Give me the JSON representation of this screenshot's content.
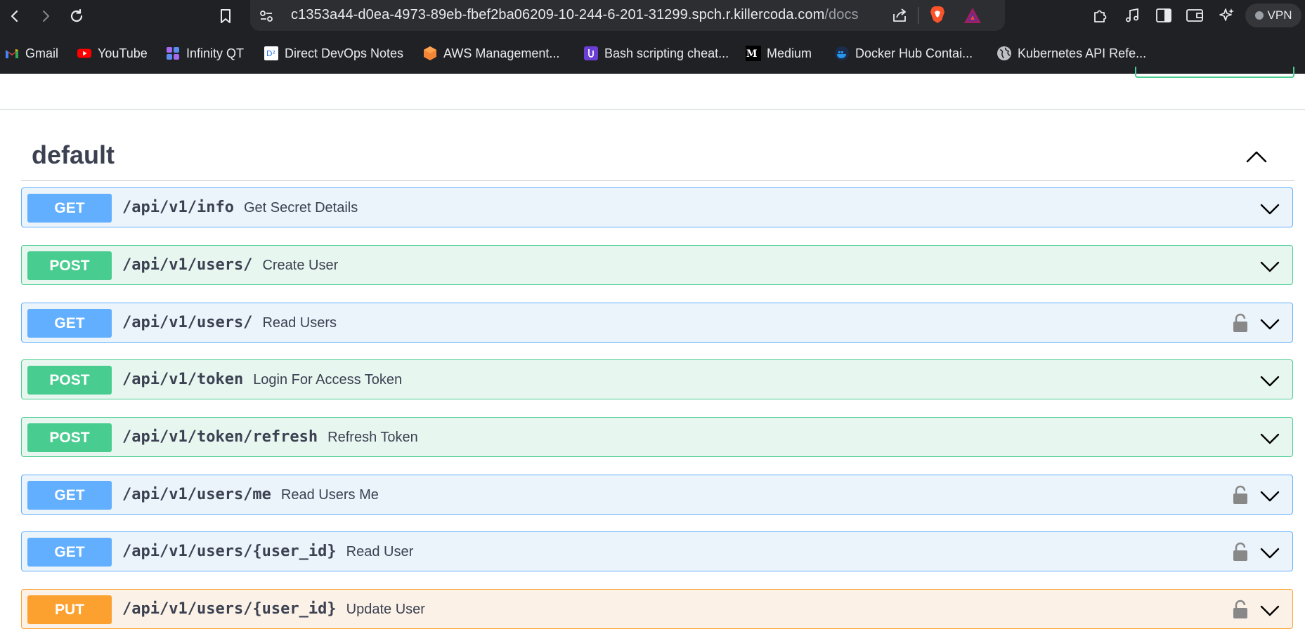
{
  "browser": {
    "url_main": "c1353a44-d0ea-4973-89eb-fbef2ba06209-10-244-6-201-31299.spch.r.killercoda.com",
    "url_path": "/docs",
    "vpn_label": "VPN",
    "icons": [
      "back-icon",
      "forward-icon",
      "reload-icon",
      "bookmark-icon",
      "site-settings-icon",
      "share-icon",
      "brave-shields-icon",
      "brave-rewards-icon",
      "extensions-icon",
      "media-icon",
      "sidebar-icon",
      "wallet-icon",
      "leo-ai-icon"
    ]
  },
  "bookmarks": [
    {
      "label": "Gmail",
      "icon": "gmail-icon"
    },
    {
      "label": "YouTube",
      "icon": "youtube-icon"
    },
    {
      "label": "Infinity QT",
      "icon": "infinity-qt-icon"
    },
    {
      "label": "Direct DevOps Notes",
      "icon": "devops-notes-icon"
    },
    {
      "label": "AWS Management...",
      "icon": "aws-icon"
    },
    {
      "label": "Bash scripting cheat...",
      "icon": "bash-icon"
    },
    {
      "label": "Medium",
      "icon": "medium-icon"
    },
    {
      "label": "Docker Hub Contai...",
      "icon": "docker-icon"
    },
    {
      "label": "Kubernetes API Refe...",
      "icon": "globe-icon"
    }
  ],
  "section": {
    "title": "default"
  },
  "colors": {
    "get": "#61affe",
    "post": "#49cc90",
    "put": "#fca130",
    "text": "#3b4151"
  },
  "operations": [
    {
      "method": "GET",
      "path": "/api/v1/info",
      "summary": "Get Secret Details",
      "locked": false
    },
    {
      "method": "POST",
      "path": "/api/v1/users/",
      "summary": "Create User",
      "locked": false
    },
    {
      "method": "GET",
      "path": "/api/v1/users/",
      "summary": "Read Users",
      "locked": true
    },
    {
      "method": "POST",
      "path": "/api/v1/token",
      "summary": "Login For Access Token",
      "locked": false
    },
    {
      "method": "POST",
      "path": "/api/v1/token/refresh",
      "summary": "Refresh Token",
      "locked": false
    },
    {
      "method": "GET",
      "path": "/api/v1/users/me",
      "summary": "Read Users Me",
      "locked": true
    },
    {
      "method": "GET",
      "path": "/api/v1/users/{user_id}",
      "summary": "Read User",
      "locked": true
    },
    {
      "method": "PUT",
      "path": "/api/v1/users/{user_id}",
      "summary": "Update User",
      "locked": true
    }
  ]
}
